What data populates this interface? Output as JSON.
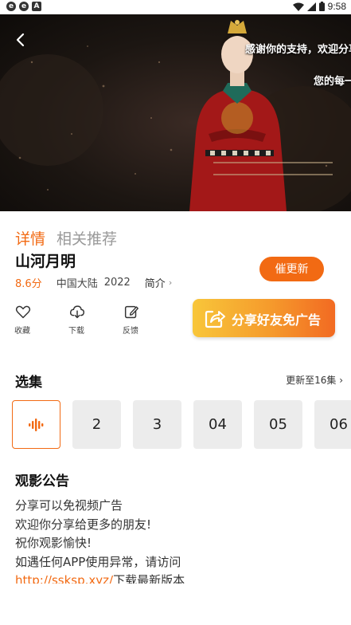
{
  "status_bar": {
    "left_icons": [
      "e",
      "e",
      "A"
    ],
    "time": "9:58"
  },
  "player": {
    "marquee_line1": "感谢你的支持，欢迎分享",
    "marquee_line2": "您的每一"
  },
  "tabs": [
    {
      "label": "详情",
      "active": true
    },
    {
      "label": "相关推荐",
      "active": false
    }
  ],
  "title": "山河月明",
  "meta": {
    "score": "8.6分",
    "region": "中国大陆",
    "year": "2022",
    "intro_label": "简介"
  },
  "urge_button": "催更新",
  "actions": [
    {
      "label": "收藏",
      "icon": "heart-icon"
    },
    {
      "label": "下载",
      "icon": "cloud-download-icon"
    },
    {
      "label": "反馈",
      "icon": "feedback-icon"
    }
  ],
  "share_button": "分享好友免广告",
  "episodes": {
    "title": "选集",
    "update_text": "更新至16集",
    "items": [
      "",
      "2",
      "3",
      "04",
      "05",
      "06"
    ]
  },
  "notice": {
    "title": "观影公告",
    "lines": [
      "分享可以免视频广告",
      "欢迎你分享给更多的朋友!",
      "祝你观影愉快!",
      "如遇任何APP使用异常，请访问"
    ],
    "link": "http://ssksp.xyz/",
    "link_suffix": "下载最新版本"
  },
  "colors": {
    "accent": "#f26a13",
    "share_gradient": [
      "#f8c63a",
      "#f26a22"
    ]
  }
}
